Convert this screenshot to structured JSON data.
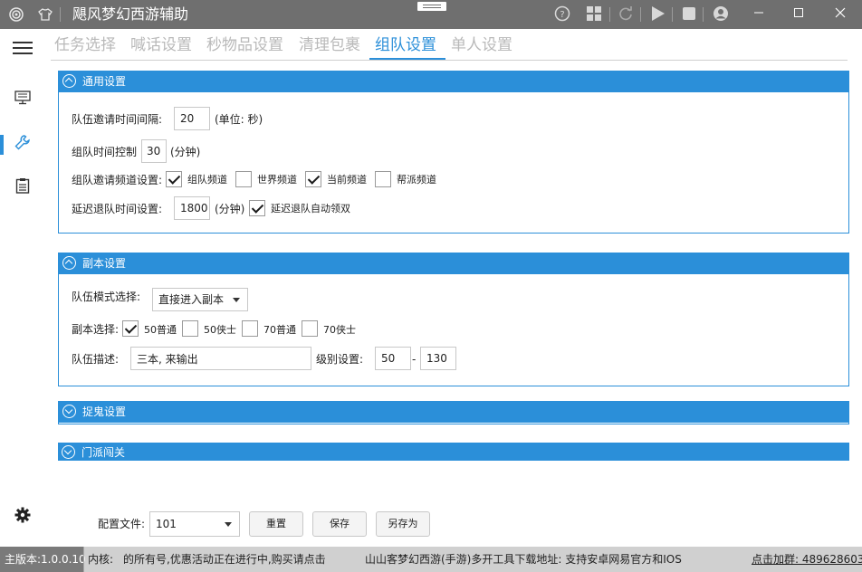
{
  "app": {
    "title": "飓风梦幻西游辅助"
  },
  "tabs": [
    {
      "label": "任务选择"
    },
    {
      "label": "喊话设置"
    },
    {
      "label": "秒物品设置"
    },
    {
      "label": "清理包裹"
    },
    {
      "label": "组队设置",
      "active": true
    },
    {
      "label": "单人设置"
    }
  ],
  "general": {
    "title": "通用设置",
    "invite_interval_label": "队伍邀请时间间隔:",
    "invite_interval_value": "20",
    "invite_interval_unit": "(单位: 秒)",
    "team_time_label": "组队时间控制",
    "team_time_value": "30",
    "team_time_unit": "(分钟)",
    "channel_label": "组队邀请频道设置:",
    "channels": [
      {
        "label": "组队频道",
        "checked": true
      },
      {
        "label": "世界频道",
        "checked": false
      },
      {
        "label": "当前频道",
        "checked": true
      },
      {
        "label": "帮派频道",
        "checked": false
      }
    ],
    "delay_label": "延迟退队时间设置:",
    "delay_value": "1800",
    "delay_unit": "(分钟)",
    "auto_double_label": "延迟退队自动领双",
    "auto_double_checked": true
  },
  "dungeon": {
    "title": "副本设置",
    "mode_label": "队伍模式选择:",
    "mode_value": "直接进入副本",
    "select_label": "副本选择:",
    "options": [
      {
        "label": "50普通",
        "checked": true
      },
      {
        "label": "50侠士",
        "checked": false
      },
      {
        "label": "70普通",
        "checked": false
      },
      {
        "label": "70侠士",
        "checked": false
      }
    ],
    "desc_label": "队伍描述:",
    "desc_value": "三本, 来输出",
    "level_label": "级别设置:",
    "level_min": "50",
    "level_dash": "-",
    "level_max": "130"
  },
  "ghost": {
    "title": "捉鬼设置"
  },
  "sect": {
    "title": "门派闯关"
  },
  "footer": {
    "config_label": "配置文件:",
    "config_value": "101",
    "reset_label": "重置",
    "save_label": "保存",
    "save_as_label": "另存为"
  },
  "status": {
    "version": "主版本:1.0.0.10",
    "beta_label": "内核:",
    "marquee": "的所有号,优惠活动正在进行中,购买请点击",
    "download_text": "山山客梦幻西游(手游)多开工具下载地址: 支持安卓网易官方和IOS",
    "group_text": "点击加群: 489628603"
  },
  "icons": {
    "logo": "swirl-logo-icon",
    "skin": "tshirt-icon",
    "help": "help-icon",
    "apps": "grid-icon",
    "refresh": "refresh-icon",
    "play": "play-icon",
    "stop": "stop-icon",
    "user": "user-icon",
    "menu": "hamburger-menu-icon",
    "monitor": "monitor-icon",
    "tools": "wrench-icon",
    "notes": "clipboard-icon",
    "settings": "gear-icon"
  },
  "colors": {
    "accent": "#2b8fd9",
    "titlebar": "#6f6f6f",
    "statusbar": "#d0d0d0"
  }
}
